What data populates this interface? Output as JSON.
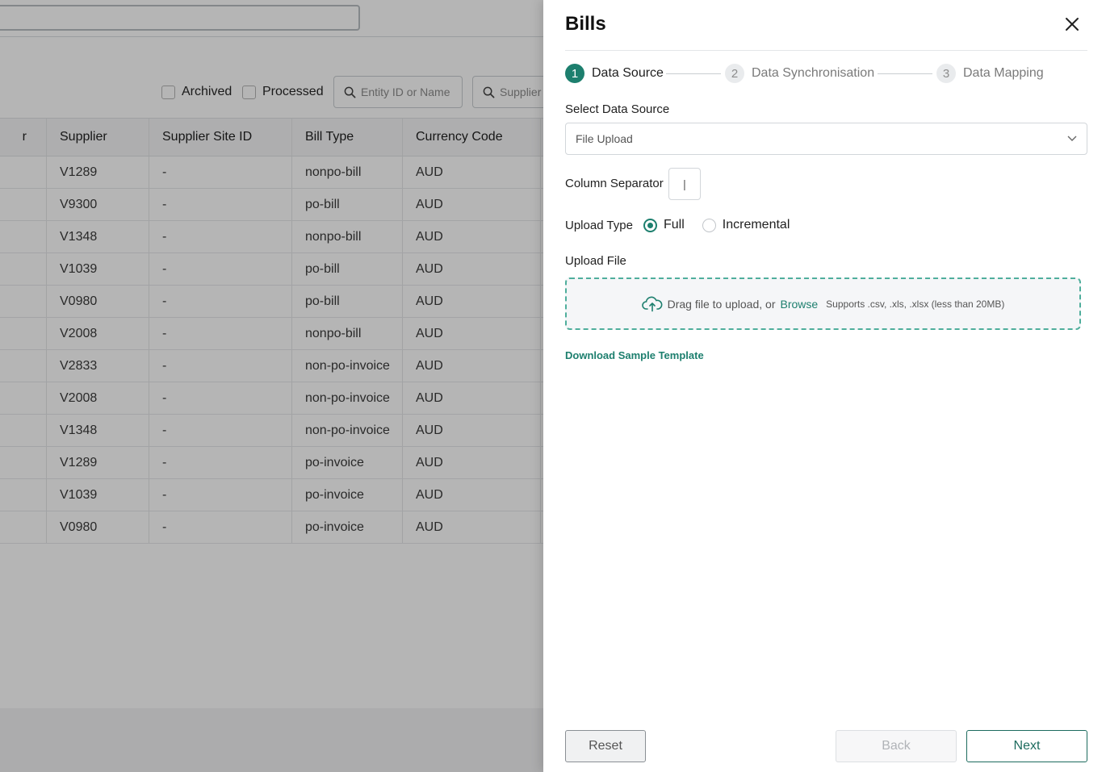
{
  "background": {
    "filters": {
      "archived_label": "Archived",
      "processed_label": "Processed",
      "entity_search_placeholder": "Entity ID or Name",
      "supplier_search_placeholder": "Supplier"
    },
    "table": {
      "columns": [
        "r",
        "Supplier",
        "Supplier Site ID",
        "Bill Type",
        "Currency Code"
      ],
      "rows": [
        [
          "V1289",
          "-",
          "nonpo-bill",
          "AUD"
        ],
        [
          "V9300",
          "-",
          "po-bill",
          "AUD"
        ],
        [
          "V1348",
          "-",
          "nonpo-bill",
          "AUD"
        ],
        [
          "V1039",
          "-",
          "po-bill",
          "AUD"
        ],
        [
          "V0980",
          "-",
          "po-bill",
          "AUD"
        ],
        [
          "V2008",
          "-",
          "nonpo-bill",
          "AUD"
        ],
        [
          "V2833",
          "-",
          "non-po-invoice",
          "AUD"
        ],
        [
          "V2008",
          "-",
          "non-po-invoice",
          "AUD"
        ],
        [
          "V1348",
          "-",
          "non-po-invoice",
          "AUD"
        ],
        [
          "V1289",
          "-",
          "po-invoice",
          "AUD"
        ],
        [
          "V1039",
          "-",
          "po-invoice",
          "AUD"
        ],
        [
          "V0980",
          "-",
          "po-invoice",
          "AUD"
        ]
      ]
    }
  },
  "drawer": {
    "title": "Bills",
    "steps": [
      {
        "num": "1",
        "label": "Data Source"
      },
      {
        "num": "2",
        "label": "Data Synchronisation"
      },
      {
        "num": "3",
        "label": "Data Mapping"
      }
    ],
    "active_step": 1,
    "select_data_source_label": "Select Data Source",
    "data_source_value": "File Upload",
    "column_separator_label": "Column Separator",
    "column_separator_value": "|",
    "upload_type_label": "Upload Type",
    "upload_type_options": [
      "Full",
      "Incremental"
    ],
    "upload_type_selected": "Full",
    "upload_file_label": "Upload File",
    "dropzone": {
      "text": "Drag file to upload, or",
      "link": "Browse",
      "hint": "Supports .csv, .xls, .xlsx  (less than 20MB)"
    },
    "download_sample_label": "Download Sample Template",
    "buttons": {
      "reset": "Reset",
      "back": "Back",
      "next": "Next"
    }
  },
  "colors": {
    "accent": "#1d7f6e",
    "overlay": "rgba(0,0,0,0.29)"
  }
}
